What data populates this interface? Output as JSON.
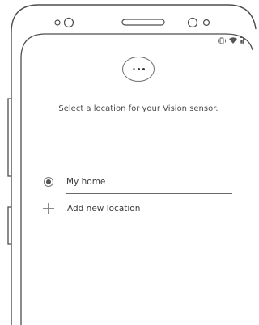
{
  "screen": {
    "more_button_label": "...",
    "prompt": "Select a location for your Vision sensor."
  },
  "locations": [
    {
      "label": "My home",
      "selected": true,
      "icon": "radio-selected-icon"
    },
    {
      "label": "Add new location",
      "icon": "plus-icon"
    }
  ],
  "status_bar": {
    "icons": [
      "vibrate-icon",
      "wifi-icon",
      "battery-icon"
    ]
  },
  "colors": {
    "outline": "#555555",
    "text": "#3a3a3a",
    "background": "#ffffff"
  }
}
